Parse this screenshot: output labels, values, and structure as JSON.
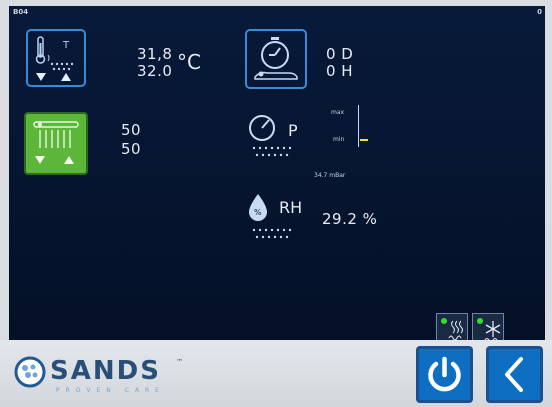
{
  "screen": {
    "left_label": "B04",
    "right_label": "0"
  },
  "temperature": {
    "label": "T",
    "actual": "31,8",
    "setpoint": "32.0",
    "unit": "°C"
  },
  "timer": {
    "days": "0 D",
    "hours": "0 H"
  },
  "humidifier_stage": {
    "line1": "50",
    "line2": "50"
  },
  "pressure": {
    "label": "P",
    "max_label": "max",
    "min_label": "min",
    "reading": "34.7 mBar"
  },
  "humidity": {
    "label": "RH",
    "value": "29.2 %",
    "drop_label": "%"
  },
  "mode_indicators": [
    {
      "name": "heating-mode",
      "status_color": "#2fe02f"
    },
    {
      "name": "cooling-mode",
      "status_color": "#2fe02f"
    }
  ],
  "footer": {
    "brand": "SANDS",
    "tagline": "PROVEN CARE",
    "trademark": "™"
  },
  "colors": {
    "accent": "#3a8bd6",
    "active_green": "#5bb63a",
    "button_blue": "#0e6fc2",
    "screen_bg": "#06142e"
  },
  "icons": [
    "thermometer-icon",
    "stopwatch-icon",
    "humidifier-icon",
    "pressure-gauge-icon",
    "humidity-drop-icon",
    "power-icon",
    "back-chevron-icon"
  ]
}
